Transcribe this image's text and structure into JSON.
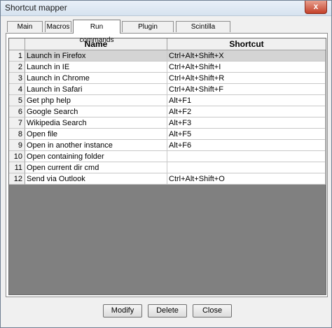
{
  "window": {
    "title": "Shortcut mapper",
    "close_label": "x"
  },
  "tabs": [
    {
      "label": "Main menu",
      "active": false
    },
    {
      "label": "Macros",
      "active": false
    },
    {
      "label": "Run commands",
      "active": true
    },
    {
      "label": "Plugin commands",
      "active": false
    },
    {
      "label": "Scintilla commands",
      "active": false
    }
  ],
  "table": {
    "columns": [
      "Name",
      "Shortcut"
    ],
    "selected_row": 1,
    "rows": [
      {
        "num": "1",
        "name": "Launch in Firefox",
        "shortcut": "Ctrl+Alt+Shift+X"
      },
      {
        "num": "2",
        "name": "Launch in IE",
        "shortcut": "Ctrl+Alt+Shift+I"
      },
      {
        "num": "3",
        "name": "Launch in Chrome",
        "shortcut": "Ctrl+Alt+Shift+R"
      },
      {
        "num": "4",
        "name": "Launch in Safari",
        "shortcut": "Ctrl+Alt+Shift+F"
      },
      {
        "num": "5",
        "name": "Get php help",
        "shortcut": "Alt+F1"
      },
      {
        "num": "6",
        "name": "Google Search",
        "shortcut": "Alt+F2"
      },
      {
        "num": "7",
        "name": "Wikipedia Search",
        "shortcut": "Alt+F3"
      },
      {
        "num": "8",
        "name": "Open file",
        "shortcut": "Alt+F5"
      },
      {
        "num": "9",
        "name": "Open in another instance",
        "shortcut": "Alt+F6"
      },
      {
        "num": "10",
        "name": "Open containing folder",
        "shortcut": ""
      },
      {
        "num": "11",
        "name": "Open current dir cmd",
        "shortcut": ""
      },
      {
        "num": "12",
        "name": "Send via Outlook",
        "shortcut": "Ctrl+Alt+Shift+O"
      }
    ]
  },
  "buttons": {
    "modify": "Modify",
    "delete": "Delete",
    "close": "Close"
  }
}
